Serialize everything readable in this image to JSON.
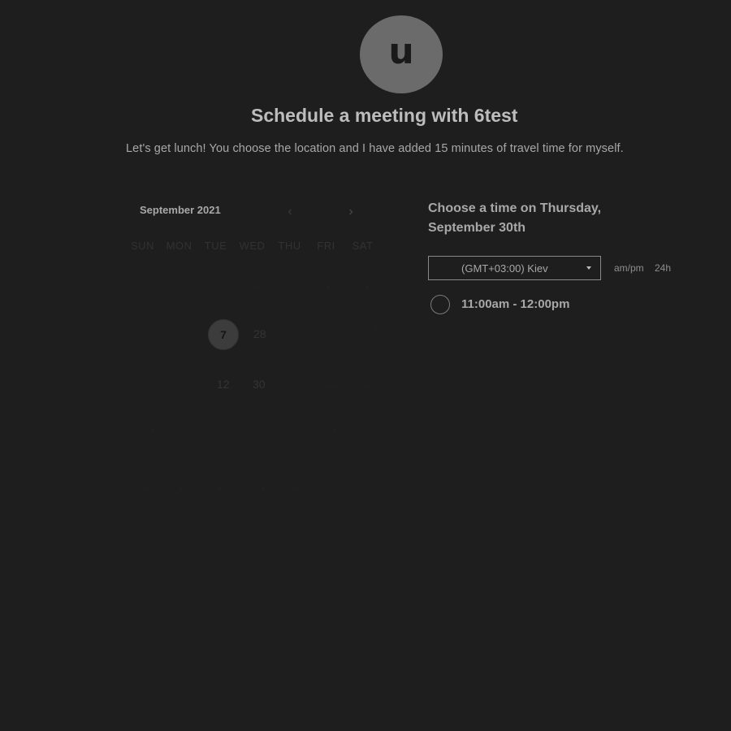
{
  "host": {
    "avatar_initial": "u"
  },
  "header": {
    "title": "Schedule a meeting with 6test",
    "description": "Let's get lunch! You choose the location and I have added 15 minutes of travel time for myself."
  },
  "calendar": {
    "month_label": "September 2021",
    "prev_icon": "chevron-left-icon",
    "next_icon": "chevron-right-icon",
    "weekdays": [
      "SUN",
      "MON",
      "TUE",
      "WED",
      "THU",
      "FRI",
      "SAT"
    ],
    "days": {
      "d7": "7",
      "d28": "28",
      "d12": "12",
      "d30": "30"
    }
  },
  "slots": {
    "choose_title": "Choose a time on Thursday, September 30th",
    "timezone": "(GMT+03:00) Kiev",
    "format_ampm": "am/pm",
    "format_24h": "24h",
    "times": [
      "11:00am - 12:00pm"
    ]
  }
}
